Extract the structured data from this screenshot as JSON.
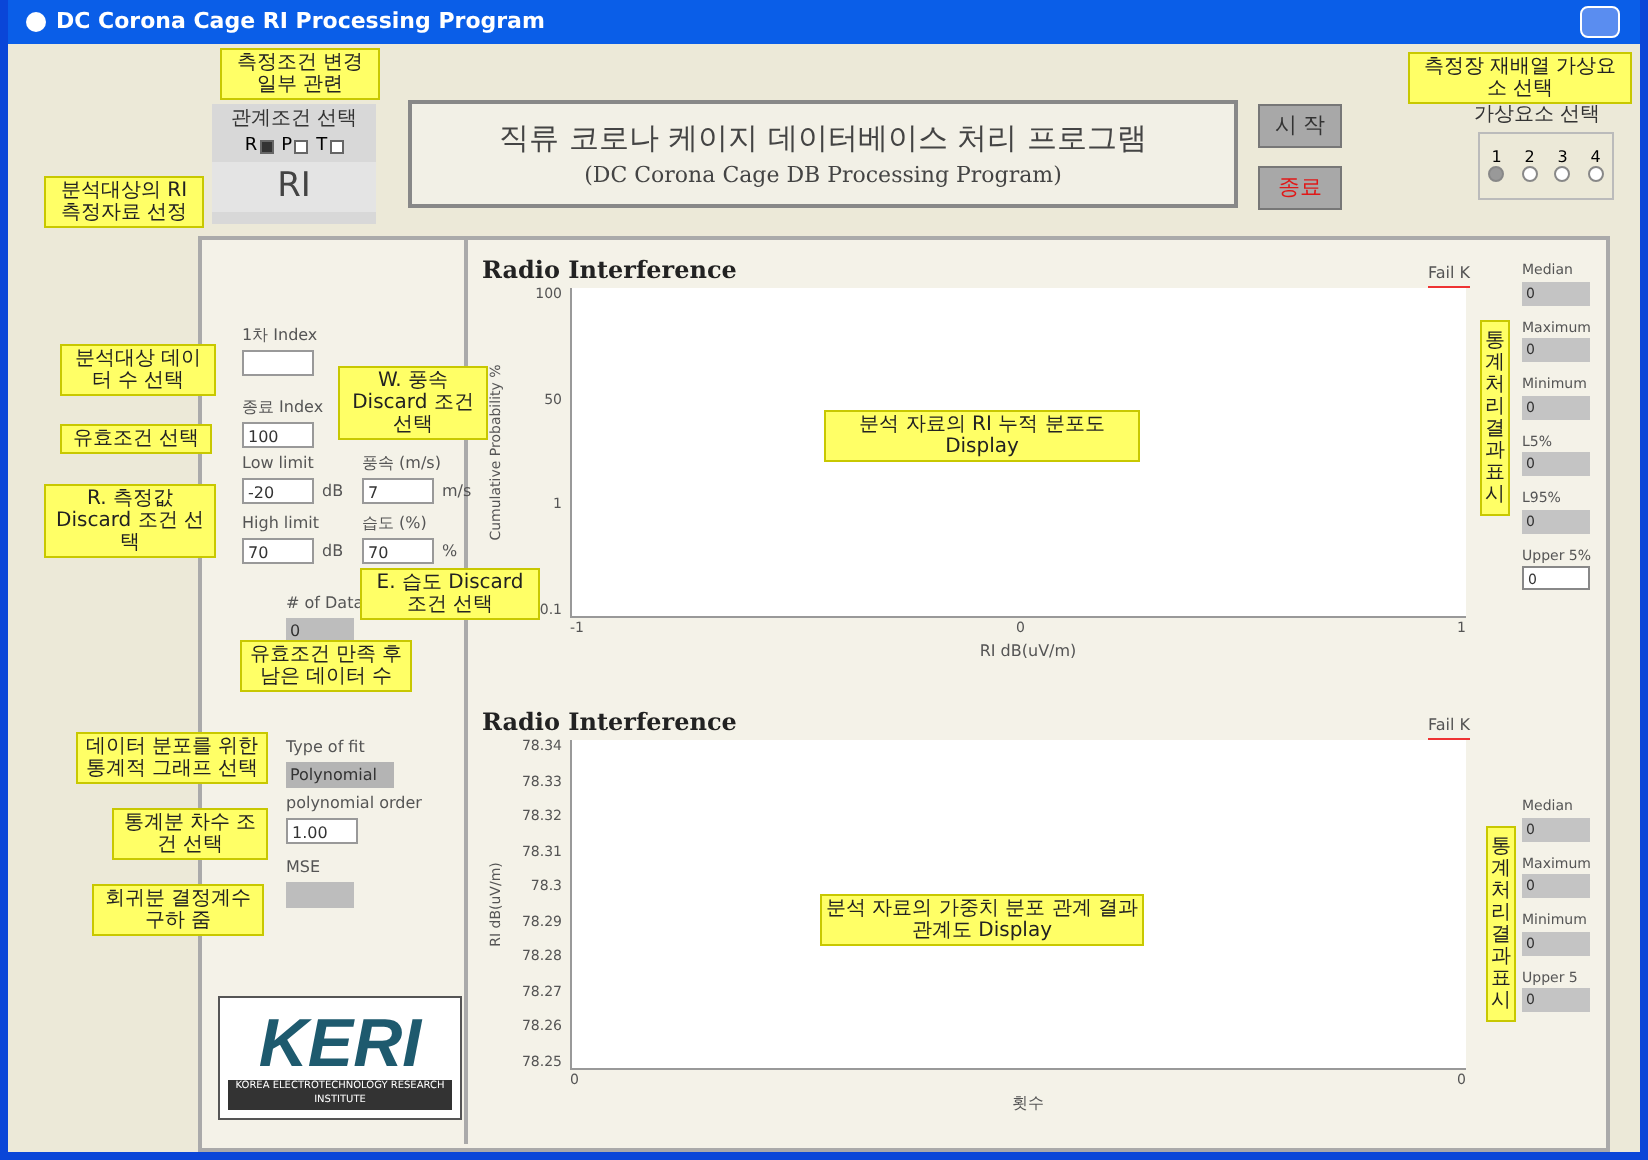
{
  "window": {
    "title": "DC Corona Cage RI Processing Program"
  },
  "condition_group": {
    "label": "관계조건 선택",
    "options": [
      {
        "label": "R",
        "selected": true
      },
      {
        "label": "P",
        "selected": false
      },
      {
        "label": "T",
        "selected": false
      }
    ],
    "value": "RI"
  },
  "heading": {
    "title": "직류 코로나 케이지 데이터베이스 처리 프로그램",
    "subtitle": "(DC Corona Cage DB Processing Program)"
  },
  "buttons": [
    {
      "label": "시 작",
      "kind": "start"
    },
    {
      "label": "종료",
      "kind": "stop"
    }
  ],
  "element_group": {
    "label": "가상요소 선택",
    "options": [
      {
        "label": "1",
        "selected": true
      },
      {
        "label": "2",
        "selected": false
      },
      {
        "label": "3",
        "selected": false
      },
      {
        "label": "4",
        "selected": false
      }
    ]
  },
  "controls": [
    {
      "label": "1차 Index",
      "kind": "field"
    },
    {
      "label": "종료 Index",
      "value": "100",
      "kind": "field"
    },
    {
      "label": "Low limit",
      "value": "-20",
      "unit": "dB",
      "kind": "field"
    },
    {
      "label": "풍속 (m/s)",
      "value": "7",
      "unit": "m/s",
      "kind": "field"
    },
    {
      "label": "High limit",
      "value": "70",
      "unit": "dB",
      "kind": "field"
    },
    {
      "label": "습도 (%)",
      "value": "70",
      "unit": "%",
      "kind": "field"
    },
    {
      "label": "# of Data",
      "value": "0",
      "kind": "indicator"
    },
    {
      "label": "Type of fit",
      "value": "Polynomial",
      "kind": "dropdown"
    },
    {
      "label": "polynomial order",
      "value": "1.00",
      "kind": "field"
    },
    {
      "label": "MSE",
      "kind": "indicator"
    }
  ],
  "charts": [
    {
      "title": "Radio Interference",
      "legend": "Fail K",
      "ylabel": "Cumulative Probability %",
      "yticks": [
        "100",
        "50",
        "1",
        "0.1"
      ],
      "xticks": [
        "-1",
        "0",
        "1"
      ],
      "xlabel": "RI dB(uV/m)",
      "stats": [
        {
          "label": "Median",
          "value": "0",
          "kind": "indicator"
        },
        {
          "label": "Maximum",
          "value": "0",
          "kind": "indicator"
        },
        {
          "label": "Minimum",
          "value": "0",
          "kind": "indicator"
        },
        {
          "label": "L5%",
          "value": "0",
          "kind": "indicator"
        },
        {
          "label": "L95%",
          "value": "0",
          "kind": "indicator"
        },
        {
          "label": "Upper 5%",
          "value": "0",
          "kind": "field"
        }
      ]
    },
    {
      "title": "Radio Interference",
      "legend": "Fail K",
      "ylabel": "RI dB(uV/m)",
      "yticks": [
        "78.34",
        "78.33",
        "78.32",
        "78.31",
        "78.3",
        "78.29",
        "78.28",
        "78.27",
        "78.26",
        "78.25"
      ],
      "xticks": [
        "0",
        "0"
      ],
      "xlabel": "횟수",
      "stats": [
        {
          "label": "Median",
          "value": "0",
          "kind": "indicator"
        },
        {
          "label": "Maximum",
          "value": "0",
          "kind": "indicator"
        },
        {
          "label": "Minimum",
          "value": "0",
          "kind": "indicator"
        },
        {
          "label": "Upper 5",
          "value": "0",
          "kind": "indicator"
        }
      ]
    }
  ],
  "notes": [
    {
      "text": "측정조건 변경 일부 관련"
    },
    {
      "text": "측정장 재배열 가상요소 선택"
    },
    {
      "text": "분석대상의 RI 측정자료 선정"
    },
    {
      "text": "분석대상 데이터 수 선택"
    },
    {
      "text": "유효조건 선택"
    },
    {
      "text": "R. 측정값 Discard 조건 선택"
    },
    {
      "text": "W. 풍속 Discard 조건 선택"
    },
    {
      "text": "E. 습도 Discard 조건 선택"
    },
    {
      "text": "유효조건 만족 후 남은 데이터 수"
    },
    {
      "text": "데이터 분포를 위한 통계적 그래프 선택"
    },
    {
      "text": "통계분 차수 조건 선택"
    },
    {
      "text": "회귀분 결정계수 구하 줌"
    },
    {
      "text": "분석 자료의 RI 누적 분포도 Display"
    },
    {
      "text": "분석 자료의 가중치 분포 관계 결과 관계도 Display"
    },
    {
      "text": "통계처리 결과 표시",
      "kind": "vertical"
    },
    {
      "text": "통계처리 결과 표시",
      "kind": "vertical"
    }
  ],
  "logo": {
    "text": "KERI",
    "caption": "KOREA ELECTROTECHNOLOGY RESEARCH INSTITUTE"
  }
}
